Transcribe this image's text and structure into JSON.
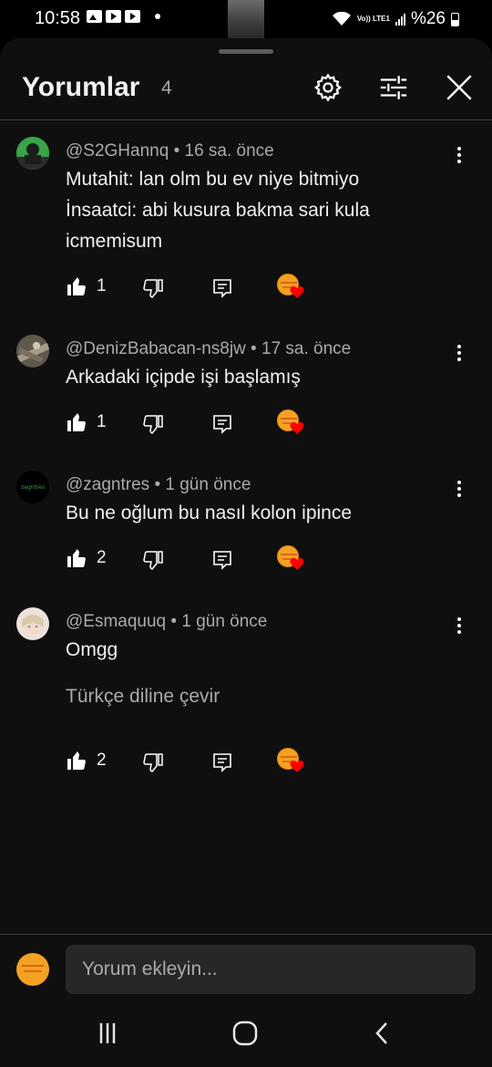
{
  "status_bar": {
    "time": "10:58",
    "battery": "%26",
    "volte": "Vo)) LTE1"
  },
  "header": {
    "title": "Yorumlar",
    "count": "4"
  },
  "comments": [
    {
      "author": "@S2GHannq",
      "time": "16 sa. önce",
      "text": "Mutahit: lan olm bu ev niye bitmiyo\nİnsaatci: abi kusura bakma sari kula icmemisum",
      "likes": "1",
      "avatar_color": "#3aa346"
    },
    {
      "author": "@DenizBabacan-ns8jw",
      "time": "17 sa. önce",
      "text": "Arkadaki içipde işi başlamış",
      "likes": "1",
      "avatar_color": "#6b6458"
    },
    {
      "author": "@zagntres",
      "time": "1 gün önce",
      "text": "Bu ne oğlum bu nasıl kolon ipince",
      "likes": "2",
      "avatar_text": "zagntres",
      "avatar_color": "#000000"
    },
    {
      "author": "@Esmaquuq",
      "time": "1 gün önce",
      "text": "Omgg",
      "translate": "Türkçe diline çevir",
      "likes": "2",
      "avatar_color": "#e9dcd6"
    }
  ],
  "composer": {
    "placeholder": "Yorum ekleyin..."
  },
  "colors": {
    "background": "#0f0f0f",
    "text_primary": "#f1f1f1",
    "text_secondary": "#aaaaaa",
    "input_bg": "#272727",
    "heart_red": "#ff0000",
    "creator_avatar": "#f4a123"
  }
}
